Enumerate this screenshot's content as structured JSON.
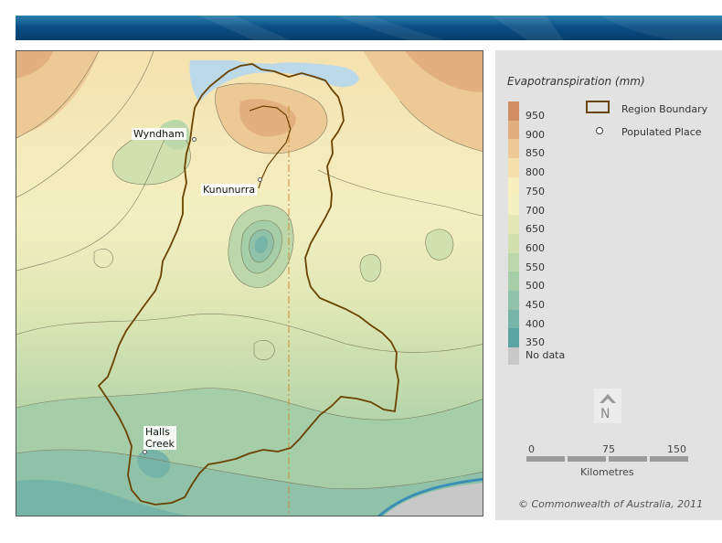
{
  "legend": {
    "title": "Evapotranspiration (mm)",
    "classes": [
      {
        "label": "950",
        "color": "#d18f61"
      },
      {
        "label": "900",
        "color": "#e2b07e"
      },
      {
        "label": "850",
        "color": "#edc995"
      },
      {
        "label": "800",
        "color": "#f6e0ab"
      },
      {
        "label": "750",
        "color": "#f9efbd"
      },
      {
        "label": "700",
        "color": "#f3f0c2"
      },
      {
        "label": "650",
        "color": "#e3e8b5"
      },
      {
        "label": "600",
        "color": "#d0e0ae"
      },
      {
        "label": "550",
        "color": "#bcd8aa"
      },
      {
        "label": "500",
        "color": "#a5cda8"
      },
      {
        "label": "450",
        "color": "#8fc2a8"
      },
      {
        "label": "400",
        "color": "#75b4a6"
      },
      {
        "label": "350",
        "color": "#5aa5a3"
      }
    ],
    "no_data_label": "No data",
    "no_data_color": "#c8c8c8",
    "region_boundary_label": "Region Boundary",
    "region_boundary_color": "#6b4300",
    "populated_place_label": "Populated Place",
    "north_label": "N",
    "scale": {
      "ticks": [
        "0",
        "75",
        "150"
      ],
      "unit": "Kilometres"
    },
    "copyright": "© Commonwealth of Australia, 2011"
  },
  "places": [
    {
      "name": "Wyndham"
    },
    {
      "name": "Kununurra"
    },
    {
      "name": "Halls\nCreek"
    }
  ]
}
